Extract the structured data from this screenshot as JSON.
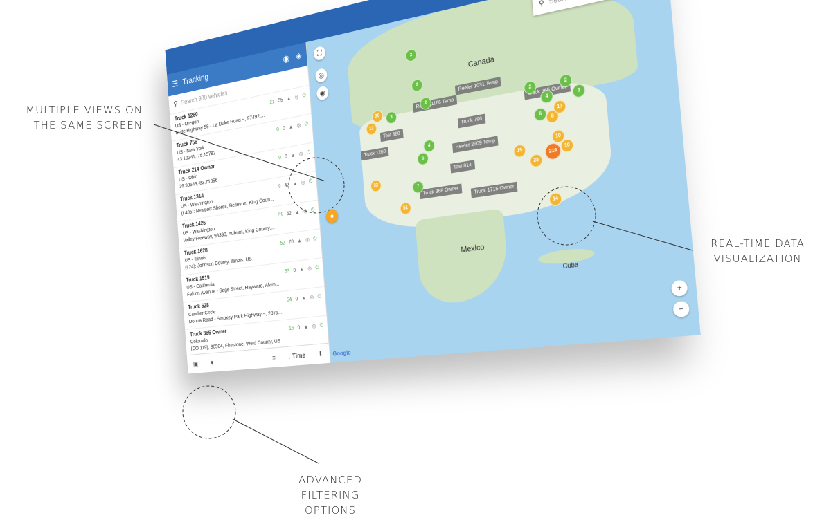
{
  "callouts": {
    "views": [
      "MULTIPLE VIEWS ON",
      "THE SAME SCREEN"
    ],
    "data": [
      "REAL-TIME DATA",
      "VISUALIZATION"
    ],
    "filter": [
      "ADVANCED",
      "FILTERING OPTIONS"
    ]
  },
  "sidebar": {
    "title": "Tracking",
    "search_placeholder": "Search 930 vehicles",
    "vehicles": [
      {
        "name": "Truck 1260",
        "line1": "US - Oregon",
        "line2": "State Highway 58 - La Duke Road ~, 97492,...",
        "s1": "21",
        "s2": "55"
      },
      {
        "name": "Truck 756",
        "line1": "US - New York",
        "line2": "43.10241,-75.15782",
        "s1": "0",
        "s2": "0"
      },
      {
        "name": "Truck 214 Owner",
        "line1": "US - Ohio",
        "line2": "39.90543,-83.71856",
        "s1": "0",
        "s2": "0"
      },
      {
        "name": "Truck 1314",
        "line1": "US - Washington",
        "line2": "(I 405): Newport Shores, Bellevue, King Coun...",
        "s1": "9",
        "s2": "42"
      },
      {
        "name": "Truck 1426",
        "line1": "US - Washington",
        "line2": "Valley Freeway, 98390, Auburn, King County,...",
        "s1": "51",
        "s2": "52"
      },
      {
        "name": "Truck 1628",
        "line1": "US - Illinois",
        "line2": "(I 24): Johnson County, Illinois, US",
        "s1": "52",
        "s2": "70"
      },
      {
        "name": "Truck 1519",
        "line1": "US - California",
        "line2": "Falcon Avenue - Sage Street, Hayward, Alam...",
        "s1": "53",
        "s2": "0"
      },
      {
        "name": "Truck 628",
        "line1": "Candler Circle",
        "line2": "Donna Road - Smokey Park Highway ~, 2871...",
        "s1": "54",
        "s2": "0"
      },
      {
        "name": "Truck 365 Owner",
        "line1": "Colorado",
        "line2": "(CO 119), 80504, Firestone, Weld County, US",
        "s1": "16",
        "s2": "0"
      }
    ],
    "footer_sort": "Time"
  },
  "map": {
    "search_placeholder": "Search",
    "labels": [
      "Canada",
      "Mexico",
      "Cuba",
      "Google"
    ],
    "tags": [
      "Reefer 1166 Temp",
      "Reefer 1031 Temp",
      "Test 388",
      "Truck 1260",
      "Truck 790",
      "Reefer 2909 Temp",
      "Test 814",
      "Truck 368 Owner",
      "Truck 1715 Owner",
      "Truck 365 Owner"
    ],
    "clusters": [
      "2",
      "2",
      "2",
      "30",
      "12",
      "3",
      "2",
      "4",
      "6",
      "8",
      "13",
      "10",
      "219",
      "28",
      "10",
      "51",
      "32",
      "7",
      "5",
      "4",
      "15",
      "14",
      "2",
      "3"
    ]
  }
}
